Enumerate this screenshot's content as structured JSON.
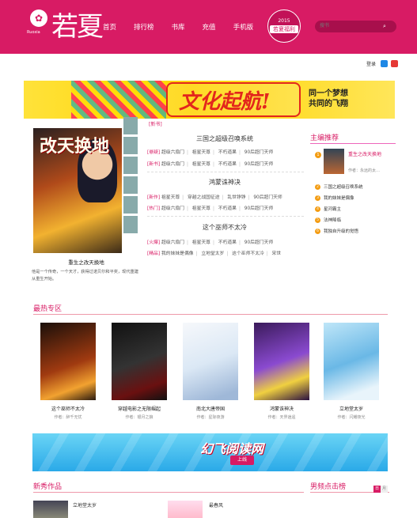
{
  "header": {
    "logo_text": "若夏",
    "logo_sub": "Ruoxia",
    "nav": [
      "首页",
      "排行榜",
      "书库",
      "充值",
      "手机版"
    ],
    "badge_year": "2015",
    "badge_text": "若夏福利",
    "search_placeholder": "搜书",
    "brand_color": "#d81b64"
  },
  "login": {
    "label": "登录"
  },
  "banner": {
    "slogan": "文化起航!",
    "sub_line1": "同一个梦想",
    "sub_line2": "共同的飞翔"
  },
  "feature": {
    "title": "重生之改天换地",
    "cover_text": "改天换地",
    "desc": "他是一个传奇，一个天才，获得过诺贝尔和平奖，现代重建从重生开始。"
  },
  "center": {
    "new_tag": "[新书]",
    "block1_title": "三国之超级召唤系统",
    "block1_rows": [
      [
        "[悬疑]",
        "超级六扇门",
        "祖星天尊",
        "不朽道果",
        "90后超门天师"
      ],
      [
        "[新书]",
        "超级六扇门",
        "祖星天尊",
        "不朽道果",
        "90后超门天师"
      ]
    ],
    "block2_title": "鸿蒙诛神决",
    "block2_rows": [
      [
        "[新作]",
        "祖星天尊",
        "穿越之战国征途",
        "乱世铮铮",
        "90后超门天师"
      ],
      [
        "[热门]",
        "超级六扇门",
        "祖星天尊",
        "不朽道果",
        "90后超门天师"
      ]
    ],
    "block3_title": "这个巫师不太冷",
    "block3_rows": [
      [
        "[火爆]",
        "超级六扇门",
        "祖星天尊",
        "不朽道果",
        "90后超门天师"
      ],
      [
        "[精品]",
        "我的妹妹是偶像",
        "立地堂太岁",
        "这个巫师不太冷",
        "宋世"
      ]
    ]
  },
  "recommend": {
    "head": "主编推荐",
    "top_title": "重生之改天换地",
    "top_author": "作者：永远的太…",
    "items": [
      "三国之超级召唤系统",
      "我的妹妹是偶像",
      "星河霸主",
      "法神降临",
      "我独自升级的觉悟"
    ]
  },
  "hot": {
    "head": "最热专区",
    "books": [
      {
        "title": "这个巫师不太冷",
        "author": "作者：醉千无忧"
      },
      {
        "title": "穿越电影之无限崛起",
        "author": "作者：银月之狼"
      },
      {
        "title": "南北大唐帝国",
        "author": "作者：星际夜游"
      },
      {
        "title": "鸿蒙诛神决",
        "author": "作者：天界逍遥"
      },
      {
        "title": "立地堂太岁",
        "author": "作者：闪耀夜光"
      }
    ]
  },
  "banner2": {
    "text": "幻飞阅读网",
    "online": "上线"
  },
  "newbooks": {
    "head": "新秀作品",
    "item1": "立地堂太岁",
    "item2": "最春风"
  },
  "rank": {
    "head": "男频点击榜",
    "tab1": "日",
    "tab2": "月"
  }
}
